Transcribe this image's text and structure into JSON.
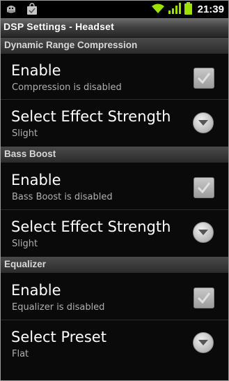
{
  "status_bar": {
    "time": "21:39",
    "icons": [
      "usb-debug-icon",
      "shopping-bag-icon",
      "wifi-icon",
      "signal-icon",
      "battery-icon"
    ]
  },
  "title": "DSP Settings - Headset",
  "sections": [
    {
      "header": "Dynamic Range Compression",
      "rows": [
        {
          "title": "Enable",
          "summary": "Compression is disabled",
          "control": "checkbox"
        },
        {
          "title": "Select Effect Strength",
          "summary": "Slight",
          "control": "dropdown"
        }
      ]
    },
    {
      "header": "Bass Boost",
      "rows": [
        {
          "title": "Enable",
          "summary": "Bass Boost is disabled",
          "control": "checkbox"
        },
        {
          "title": "Select Effect Strength",
          "summary": "Slight",
          "control": "dropdown"
        }
      ]
    },
    {
      "header": "Equalizer",
      "rows": [
        {
          "title": "Enable",
          "summary": "Equalizer is disabled",
          "control": "checkbox"
        },
        {
          "title": "Select Preset",
          "summary": "Flat",
          "control": "dropdown"
        }
      ]
    }
  ],
  "colors": {
    "background": "#050505",
    "section_header_top": "#4a4a4a",
    "section_header_bottom": "#2b2b2b",
    "checkbox_mark": "#e0e0e0",
    "status_green": "#9ee000"
  }
}
